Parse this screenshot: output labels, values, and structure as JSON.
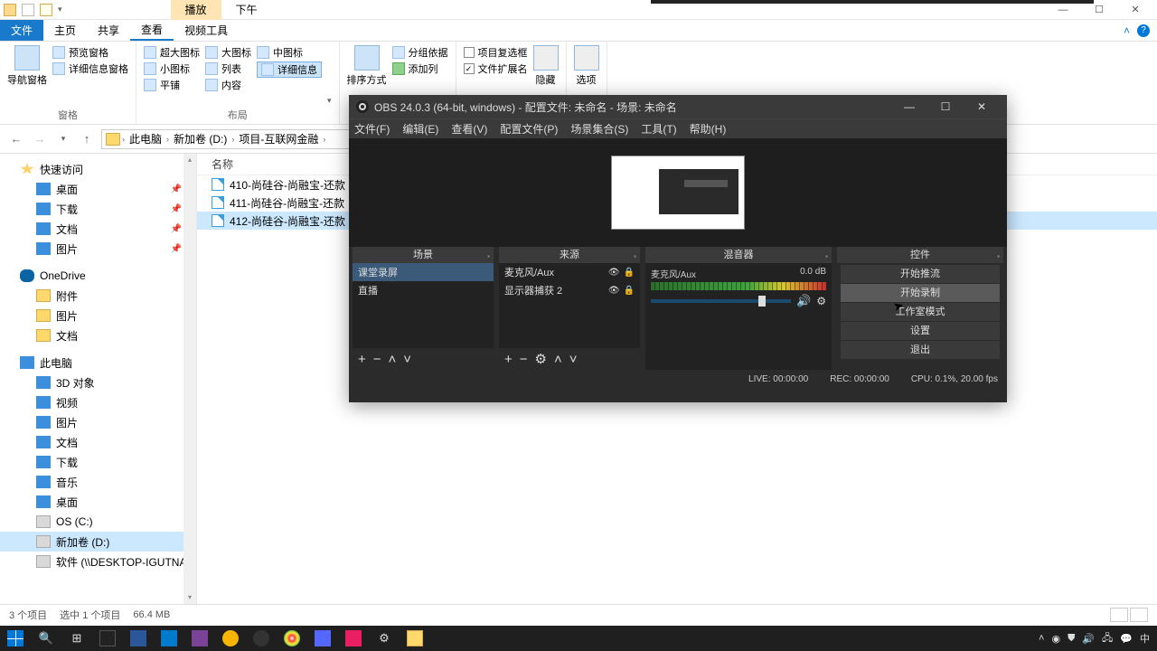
{
  "titlebar": {
    "ctx1": "播放",
    "ctx2": "下午"
  },
  "win_controls": {
    "min": "—",
    "max": "☐",
    "close": "✕"
  },
  "ribbon_tabs": {
    "file": "文件",
    "home": "主页",
    "share": "共享",
    "view": "查看",
    "video": "视频工具"
  },
  "ribbon": {
    "g1": {
      "nav": "导航窗格",
      "preview": "预览窗格",
      "details": "详细信息窗格",
      "label": "窗格"
    },
    "g2": {
      "xl": "超大图标",
      "l": "大图标",
      "m": "中图标",
      "s": "小图标",
      "list": "列表",
      "detail": "详细信息",
      "tile": "平铺",
      "content": "内容",
      "label": "布局"
    },
    "g3": {
      "sort": "排序方式",
      "group": "分组依据",
      "addcol": "添加列",
      "label": ""
    },
    "g4": {
      "chk": "项目复选框",
      "ext": "文件扩展名",
      "hide": "隐藏"
    },
    "g5": {
      "options": "选项"
    }
  },
  "breadcrumb": {
    "pc": "此电脑",
    "d": "新加卷 (D:)",
    "proj": "项目-互联网金融"
  },
  "col_name": "名称",
  "files": {
    "f0": "410-尚硅谷-尚融宝-还款",
    "f1": "411-尚硅谷-尚融宝-还款",
    "f2": "412-尚硅谷-尚融宝-还款"
  },
  "tree": {
    "quick": "快速访问",
    "desktop": "桌面",
    "downloads": "下载",
    "docs": "文档",
    "pics": "图片",
    "onedrive": "OneDrive",
    "attach": "附件",
    "pics2": "图片",
    "docs2": "文档",
    "thispc": "此电脑",
    "3d": "3D 对象",
    "video": "视频",
    "pics3": "图片",
    "docs3": "文档",
    "downloads2": "下载",
    "music": "音乐",
    "desktop2": "桌面",
    "osc": "OS (C:)",
    "newd": "新加卷 (D:)",
    "soft": "软件 (\\\\DESKTOP-IGUTNAR"
  },
  "status": {
    "count": "3 个项目",
    "sel": "选中 1 个项目",
    "size": "66.4 MB"
  },
  "obs": {
    "title": "OBS 24.0.3 (64-bit, windows) - 配置文件: 未命名 - 场景: 未命名",
    "menu": {
      "file": "文件(F)",
      "edit": "编辑(E)",
      "view": "查看(V)",
      "profile": "配置文件(P)",
      "scenes": "场景集合(S)",
      "tools": "工具(T)",
      "help": "帮助(H)"
    },
    "docks": {
      "scenes": "场景",
      "sources": "来源",
      "mixer": "混音器",
      "controls": "控件"
    },
    "scene_items": {
      "s0": "课堂录屏",
      "s1": "直播"
    },
    "source_items": {
      "s0": "麦克风/Aux",
      "s1": "显示器捕获 2"
    },
    "mixer": {
      "ch": "麦克风/Aux",
      "db": "0.0 dB"
    },
    "controls": {
      "stream": "开始推流",
      "record": "开始录制",
      "studio": "工作室模式",
      "settings": "设置",
      "exit": "退出"
    },
    "status": {
      "live": "LIVE: 00:00:00",
      "rec": "REC: 00:00:00",
      "cpu": "CPU: 0.1%, 20.00 fps"
    }
  },
  "tray": {
    "ime": "中"
  }
}
